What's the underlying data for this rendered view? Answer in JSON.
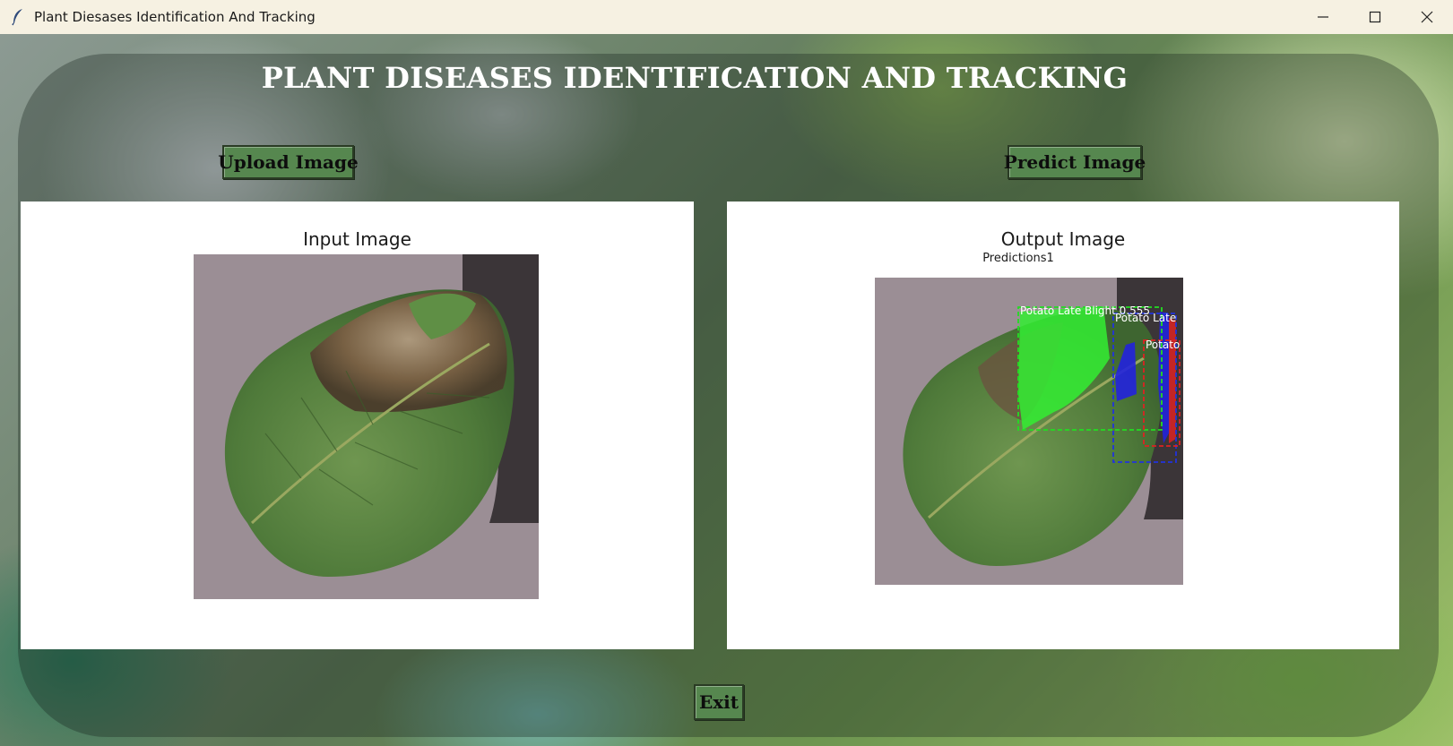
{
  "window": {
    "title": "Plant Diesases Identification And Tracking",
    "icon": "feather-icon",
    "controls": [
      "minimize-icon",
      "maximize-icon",
      "close-icon"
    ]
  },
  "header": {
    "title": "PLANT DISEASES IDENTIFICATION AND TRACKING"
  },
  "buttons": {
    "upload_label": "Upload Image",
    "predict_label": "Predict Image",
    "exit_label": "Exit"
  },
  "input_panel": {
    "title": "Input Image"
  },
  "output_panel": {
    "title": "Output Image",
    "subtitle": "Predictions1",
    "detections": [
      {
        "label": "Potato Late Blight 0.555",
        "color": "#22dd22"
      },
      {
        "label": "Potato Late",
        "color": "#2233dd"
      },
      {
        "label": "Potato",
        "color": "#dd2222"
      }
    ]
  },
  "colors": {
    "button_bg": "#56874f",
    "panel_bg": "#ffffff",
    "title_text": "#ffffff"
  }
}
